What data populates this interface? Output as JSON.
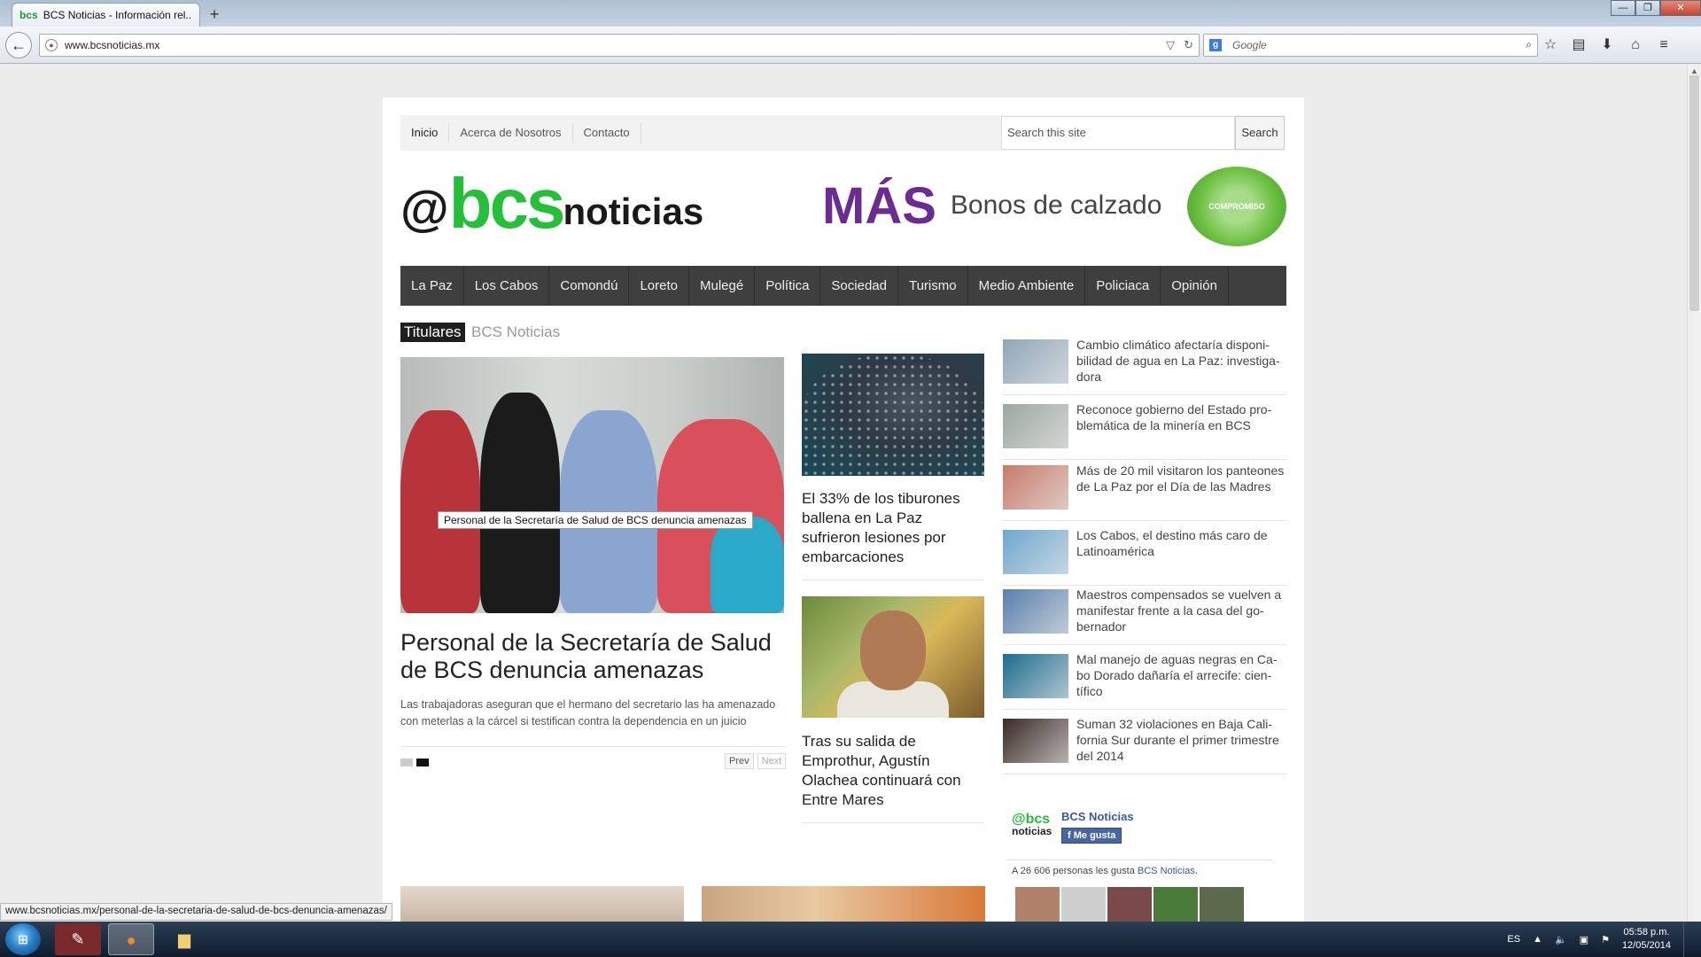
{
  "browser": {
    "tab_title": "BCS Noticias - Información rel...",
    "tab_favicon": "bcs",
    "new_tab": "+",
    "url": "www.bcsnoticias.mx",
    "search_placeholder": "Google",
    "search_engine_icon": "g",
    "status_url": "www.bcsnoticias.mx/personal-de-la-secretaria-de-salud-de-bcs-denuncia-amenazas/"
  },
  "site": {
    "top_menu": [
      "Inicio",
      "Acerca de Nosotros",
      "Contacto"
    ],
    "search_placeholder": "Search this site",
    "search_button": "Search",
    "logo": {
      "at": "@",
      "bcs": "bcs",
      "noticias": "noticias"
    },
    "ad": {
      "mas": "MÁS",
      "bonos": "Bonos de calzado",
      "seal": "COMPROMISO CUMPLIDO"
    },
    "main_nav": [
      "La Paz",
      "Los Cabos",
      "Comondú",
      "Loreto",
      "Mulegé",
      "Política",
      "Sociedad",
      "Turismo",
      "Medio Ambiente",
      "Policiaca",
      "Opinión"
    ],
    "section_label": "Titulares",
    "section_sub": "BCS Noticias"
  },
  "feature": {
    "caption": "Personal de la Secretaría de Salud de BCS denuncia amenazas",
    "title": "Personal de la Secretaría de Salud de BCS denuncia amenazas",
    "description": "Las trabajadoras aseguran que el hermano del secretario las ha amenazado con meterlas a la cárcel si testifican contra la dependencia en un juicio",
    "pager_prev": "Prev",
    "pager_next": "Next"
  },
  "middle": [
    {
      "title": "El 33% de los tiburones ballena en La Paz sufrieron lesiones por embarcaciones"
    },
    {
      "title": "Tras su salida de Emprothur, Agustín Olachea continuará con Entre Mares"
    }
  ],
  "sidebar": [
    {
      "title": "Cambio climático afectaría disponi­bilidad de agua en La Paz: investiga­dora",
      "color": "#8fa7b8"
    },
    {
      "title": "Reconoce gobierno del Estado pro­blemática de la minería en BCS",
      "color": "#9ba8a0"
    },
    {
      "title": "Más de 20 mil visitaron los panteo­nes de La Paz por el Día de las Ma­dres",
      "color": "#c97a6a"
    },
    {
      "title": "Los Cabos, el destino más caro de Latinoamérica",
      "color": "#6fa7cf"
    },
    {
      "title": "Maestros compensados se vuelven a manifestar frente a la casa del go­bernador",
      "color": "#5b7fae"
    },
    {
      "title": "Mal manejo de aguas negras en Ca­bo Dorado dañaría el arrecife: cien­tífico",
      "color": "#1e6c8c"
    },
    {
      "title": "Suman 32 violaciones en Baja Cali­fornia Sur durante el primer trimes­tre del 2014",
      "color": "#3a2a24"
    }
  ],
  "facebook": {
    "page_name": "BCS Noticias",
    "like_label": "Me gusta",
    "count_text": "A 26 606 personas les gusta ",
    "count_link": "BCS Noticias",
    "count_end": ".",
    "logo_top": "@bcs",
    "logo_bottom": "noticias"
  },
  "taskbar": {
    "language": "ES",
    "time": "05:58 p.m.",
    "date": "12/05/2014"
  }
}
